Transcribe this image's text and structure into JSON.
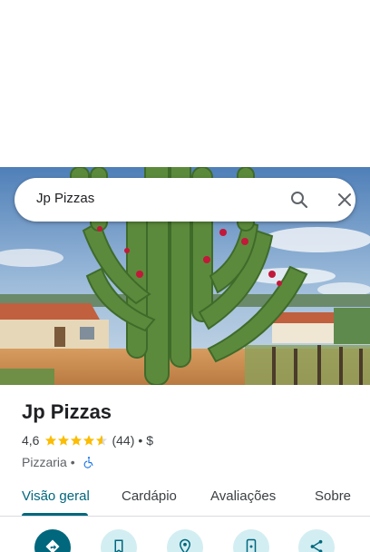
{
  "search": {
    "query": "Jp Pizzas",
    "search_icon": "search-icon",
    "close_icon": "close-icon"
  },
  "place": {
    "name": "Jp Pizzas",
    "rating": "4,6",
    "rating_value": 4.6,
    "reviews_count": "(44)",
    "separator": "•",
    "price_level": "$",
    "category": "Pizzaria",
    "accessibility_icon": "wheelchair-accessible-icon"
  },
  "tabs": [
    {
      "label": "Visão geral",
      "active": true
    },
    {
      "label": "Cardápio",
      "active": false
    },
    {
      "label": "Avaliações",
      "active": false
    },
    {
      "label": "Sobre",
      "active": false
    }
  ],
  "actions": [
    {
      "icon": "directions-icon"
    },
    {
      "icon": "bookmark-icon"
    },
    {
      "icon": "nearby-icon"
    },
    {
      "icon": "send-to-phone-icon"
    },
    {
      "icon": "share-icon"
    }
  ],
  "colors": {
    "accent": "#00677d",
    "star": "#fbbc04",
    "action_bg": "#d3eef2",
    "accessible_blue": "#1a73e8"
  }
}
